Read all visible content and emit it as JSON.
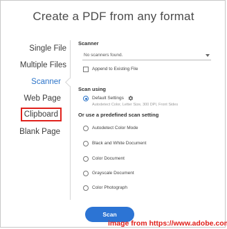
{
  "dialog": {
    "title": "Create a PDF from any format"
  },
  "nav": {
    "items": [
      {
        "label": "Single File"
      },
      {
        "label": "Multiple Files"
      },
      {
        "label": "Scanner"
      },
      {
        "label": "Web Page"
      },
      {
        "label": "Clipboard"
      },
      {
        "label": "Blank Page"
      }
    ],
    "active": "Scanner",
    "highlighted": "Clipboard",
    "highlight_color": "#e0201b",
    "active_color": "#2c74c9"
  },
  "scanner": {
    "label": "Scanner",
    "selected": "No scanners found.",
    "append_label": "Append to Existing File",
    "append_checked": false
  },
  "scan_using": {
    "label": "Scan using",
    "default_label": "Default Settings",
    "default_selected": true,
    "default_description": "Autodetect Color, Letter Size, 300 DPI, Front Sides"
  },
  "predefined": {
    "label": "Or use a predefined scan setting",
    "options": [
      {
        "label": "Autodetect Color Mode"
      },
      {
        "label": "Black and White Document"
      },
      {
        "label": "Color Document"
      },
      {
        "label": "Grayscale Document"
      },
      {
        "label": "Color Photograph"
      }
    ]
  },
  "actions": {
    "scan_label": "Scan",
    "scan_color": "#2c74d4"
  },
  "credit": {
    "text": "image from https://www.adobe.com/"
  }
}
